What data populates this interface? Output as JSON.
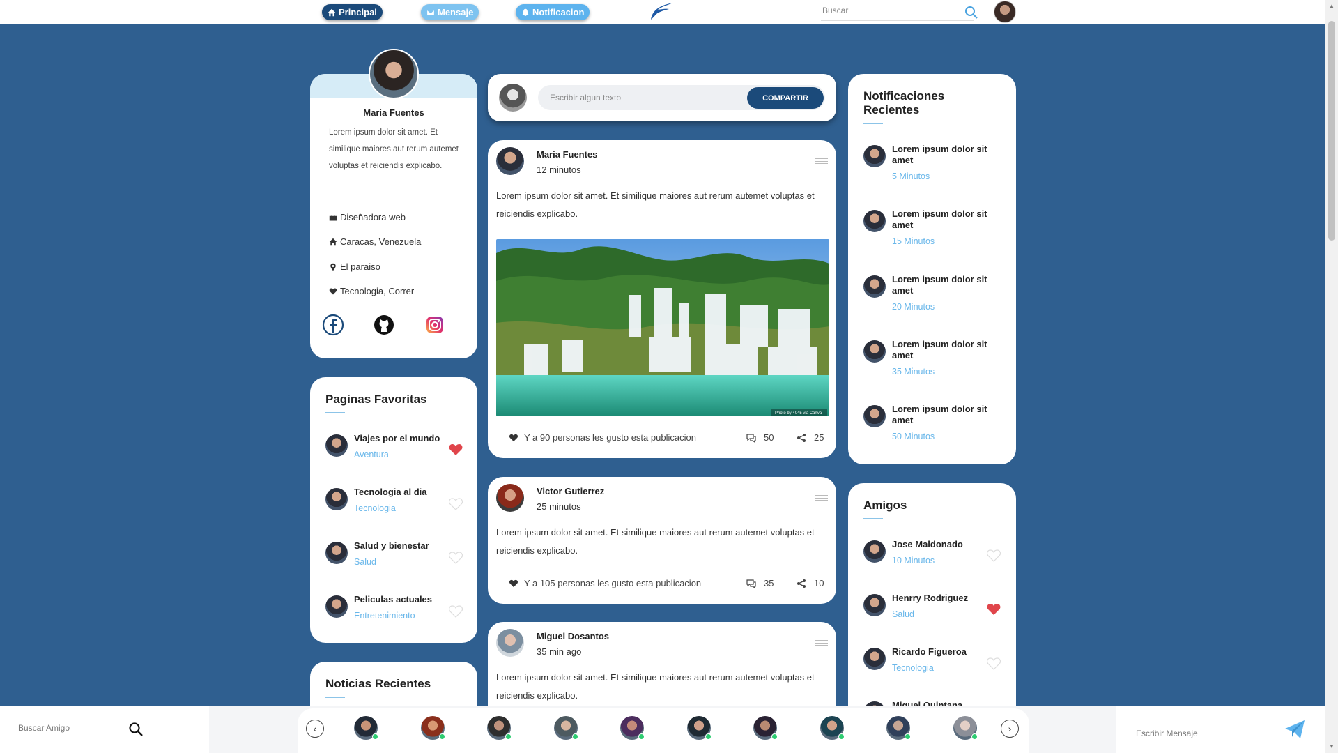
{
  "nav": {
    "principal": "Principal",
    "mensaje": "Mensaje",
    "notificacion": "Notificacion",
    "search_placeholder": "Buscar",
    "colors": {
      "principal": "#1b4a7a",
      "mensaje": "#7ec3f0",
      "notificacion": "#5db3ee"
    }
  },
  "profile": {
    "name": "Maria Fuentes",
    "bio": "Lorem ipsum dolor sit amet. Et similique maiores aut rerum autemet voluptas et reiciendis explicabo.",
    "job": "Diseñadora web",
    "home": "Caracas, Venezuela",
    "location": "El paraiso",
    "interests": "Tecnologia, Correr",
    "socials": [
      "facebook-icon",
      "github-icon",
      "instagram-icon"
    ]
  },
  "favorites": {
    "title": "Paginas Favoritas",
    "items": [
      {
        "title": "Viajes por el mundo",
        "sub": "Aventura",
        "liked": true
      },
      {
        "title": "Tecnologia al dia",
        "sub": "Tecnologia",
        "liked": false
      },
      {
        "title": "Salud y bienestar",
        "sub": "Salud",
        "liked": false
      },
      {
        "title": "Peliculas actuales",
        "sub": "Entretenimiento",
        "liked": false
      }
    ]
  },
  "news": {
    "title": "Noticias Recientes"
  },
  "composer": {
    "placeholder": "Escribir algun texto",
    "button": "COMPARTIR"
  },
  "posts": [
    {
      "author": "Maria Fuentes",
      "time": "12 minutos",
      "text": "Lorem ipsum dolor sit amet. Et similique maiores aut rerum autemet voluptas et reiciendis explicabo.",
      "likes_text": "Y a 90 personas les gusto esta publicacion",
      "comments": "50",
      "shares": "25",
      "image_credit": "Photo by 4045 via Canva"
    },
    {
      "author": "Victor Gutierrez",
      "time": "25 minutos",
      "text": "Lorem ipsum dolor sit amet. Et similique maiores aut rerum autemet voluptas et reiciendis explicabo.",
      "likes_text": "Y a 105 personas les gusto esta publicacion",
      "comments": "35",
      "shares": "10"
    },
    {
      "author": "Miguel Dosantos",
      "time": "35 min ago",
      "text": "Lorem ipsum dolor sit amet. Et similique maiores aut rerum autemet voluptas et reiciendis explicabo."
    }
  ],
  "notifications": {
    "title": "Notificaciones Recientes",
    "items": [
      {
        "title": "Lorem ipsum dolor sit amet",
        "sub": "5 Minutos"
      },
      {
        "title": "Lorem ipsum dolor sit amet",
        "sub": "15 Minutos"
      },
      {
        "title": "Lorem ipsum dolor sit amet",
        "sub": "20 Minutos"
      },
      {
        "title": "Lorem ipsum dolor sit amet",
        "sub": "35 Minutos"
      },
      {
        "title": "Lorem ipsum dolor sit amet",
        "sub": "50 Minutos"
      }
    ]
  },
  "friends": {
    "title": "Amigos",
    "items": [
      {
        "title": "Jose Maldonado",
        "sub": "10 Minutos",
        "liked": false
      },
      {
        "title": "Henrry Rodriguez",
        "sub": "Salud",
        "liked": true
      },
      {
        "title": "Ricardo Figueroa",
        "sub": "Tecnologia",
        "liked": false
      },
      {
        "title": "Miguel Quintana",
        "sub": ""
      }
    ]
  },
  "bottom": {
    "search_friend_placeholder": "Buscar Amigo",
    "message_placeholder": "Escribir Mensaje",
    "online_count": 10
  }
}
